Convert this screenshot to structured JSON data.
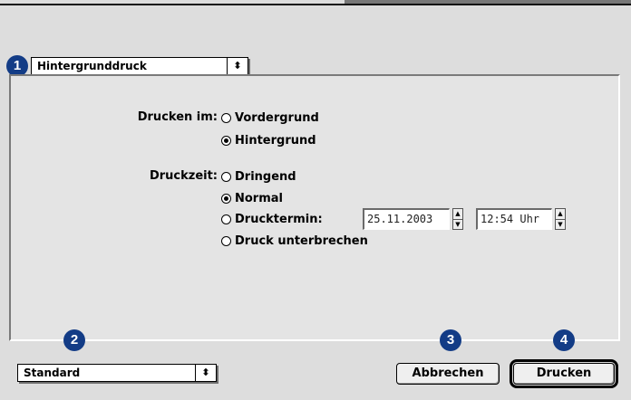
{
  "top_popup": {
    "label": "Hintergrunddruck",
    "arrow": "⬍"
  },
  "badges": [
    "1",
    "2",
    "3",
    "4"
  ],
  "print_location": {
    "label": "Drucken im:",
    "options": [
      {
        "label": "Vordergrund",
        "selected": false
      },
      {
        "label": "Hintergrund",
        "selected": true
      }
    ]
  },
  "print_time": {
    "label": "Druckzeit:",
    "options": [
      {
        "label": "Dringend",
        "selected": false
      },
      {
        "label": "Normal",
        "selected": true
      },
      {
        "label": "Drucktermin:",
        "selected": false
      },
      {
        "label": "Druck unterbrechen",
        "selected": false
      }
    ],
    "date_value": "25.11.2003",
    "time_value": "12:54 Uhr",
    "stepper_up": "▲",
    "stepper_down": "▼"
  },
  "preset_popup": {
    "label": "Standard",
    "arrow": "⬍"
  },
  "buttons": {
    "cancel": "Abbrechen",
    "print": "Drucken"
  },
  "colors": {
    "badge": "#133c86",
    "background": "#dddddd"
  }
}
